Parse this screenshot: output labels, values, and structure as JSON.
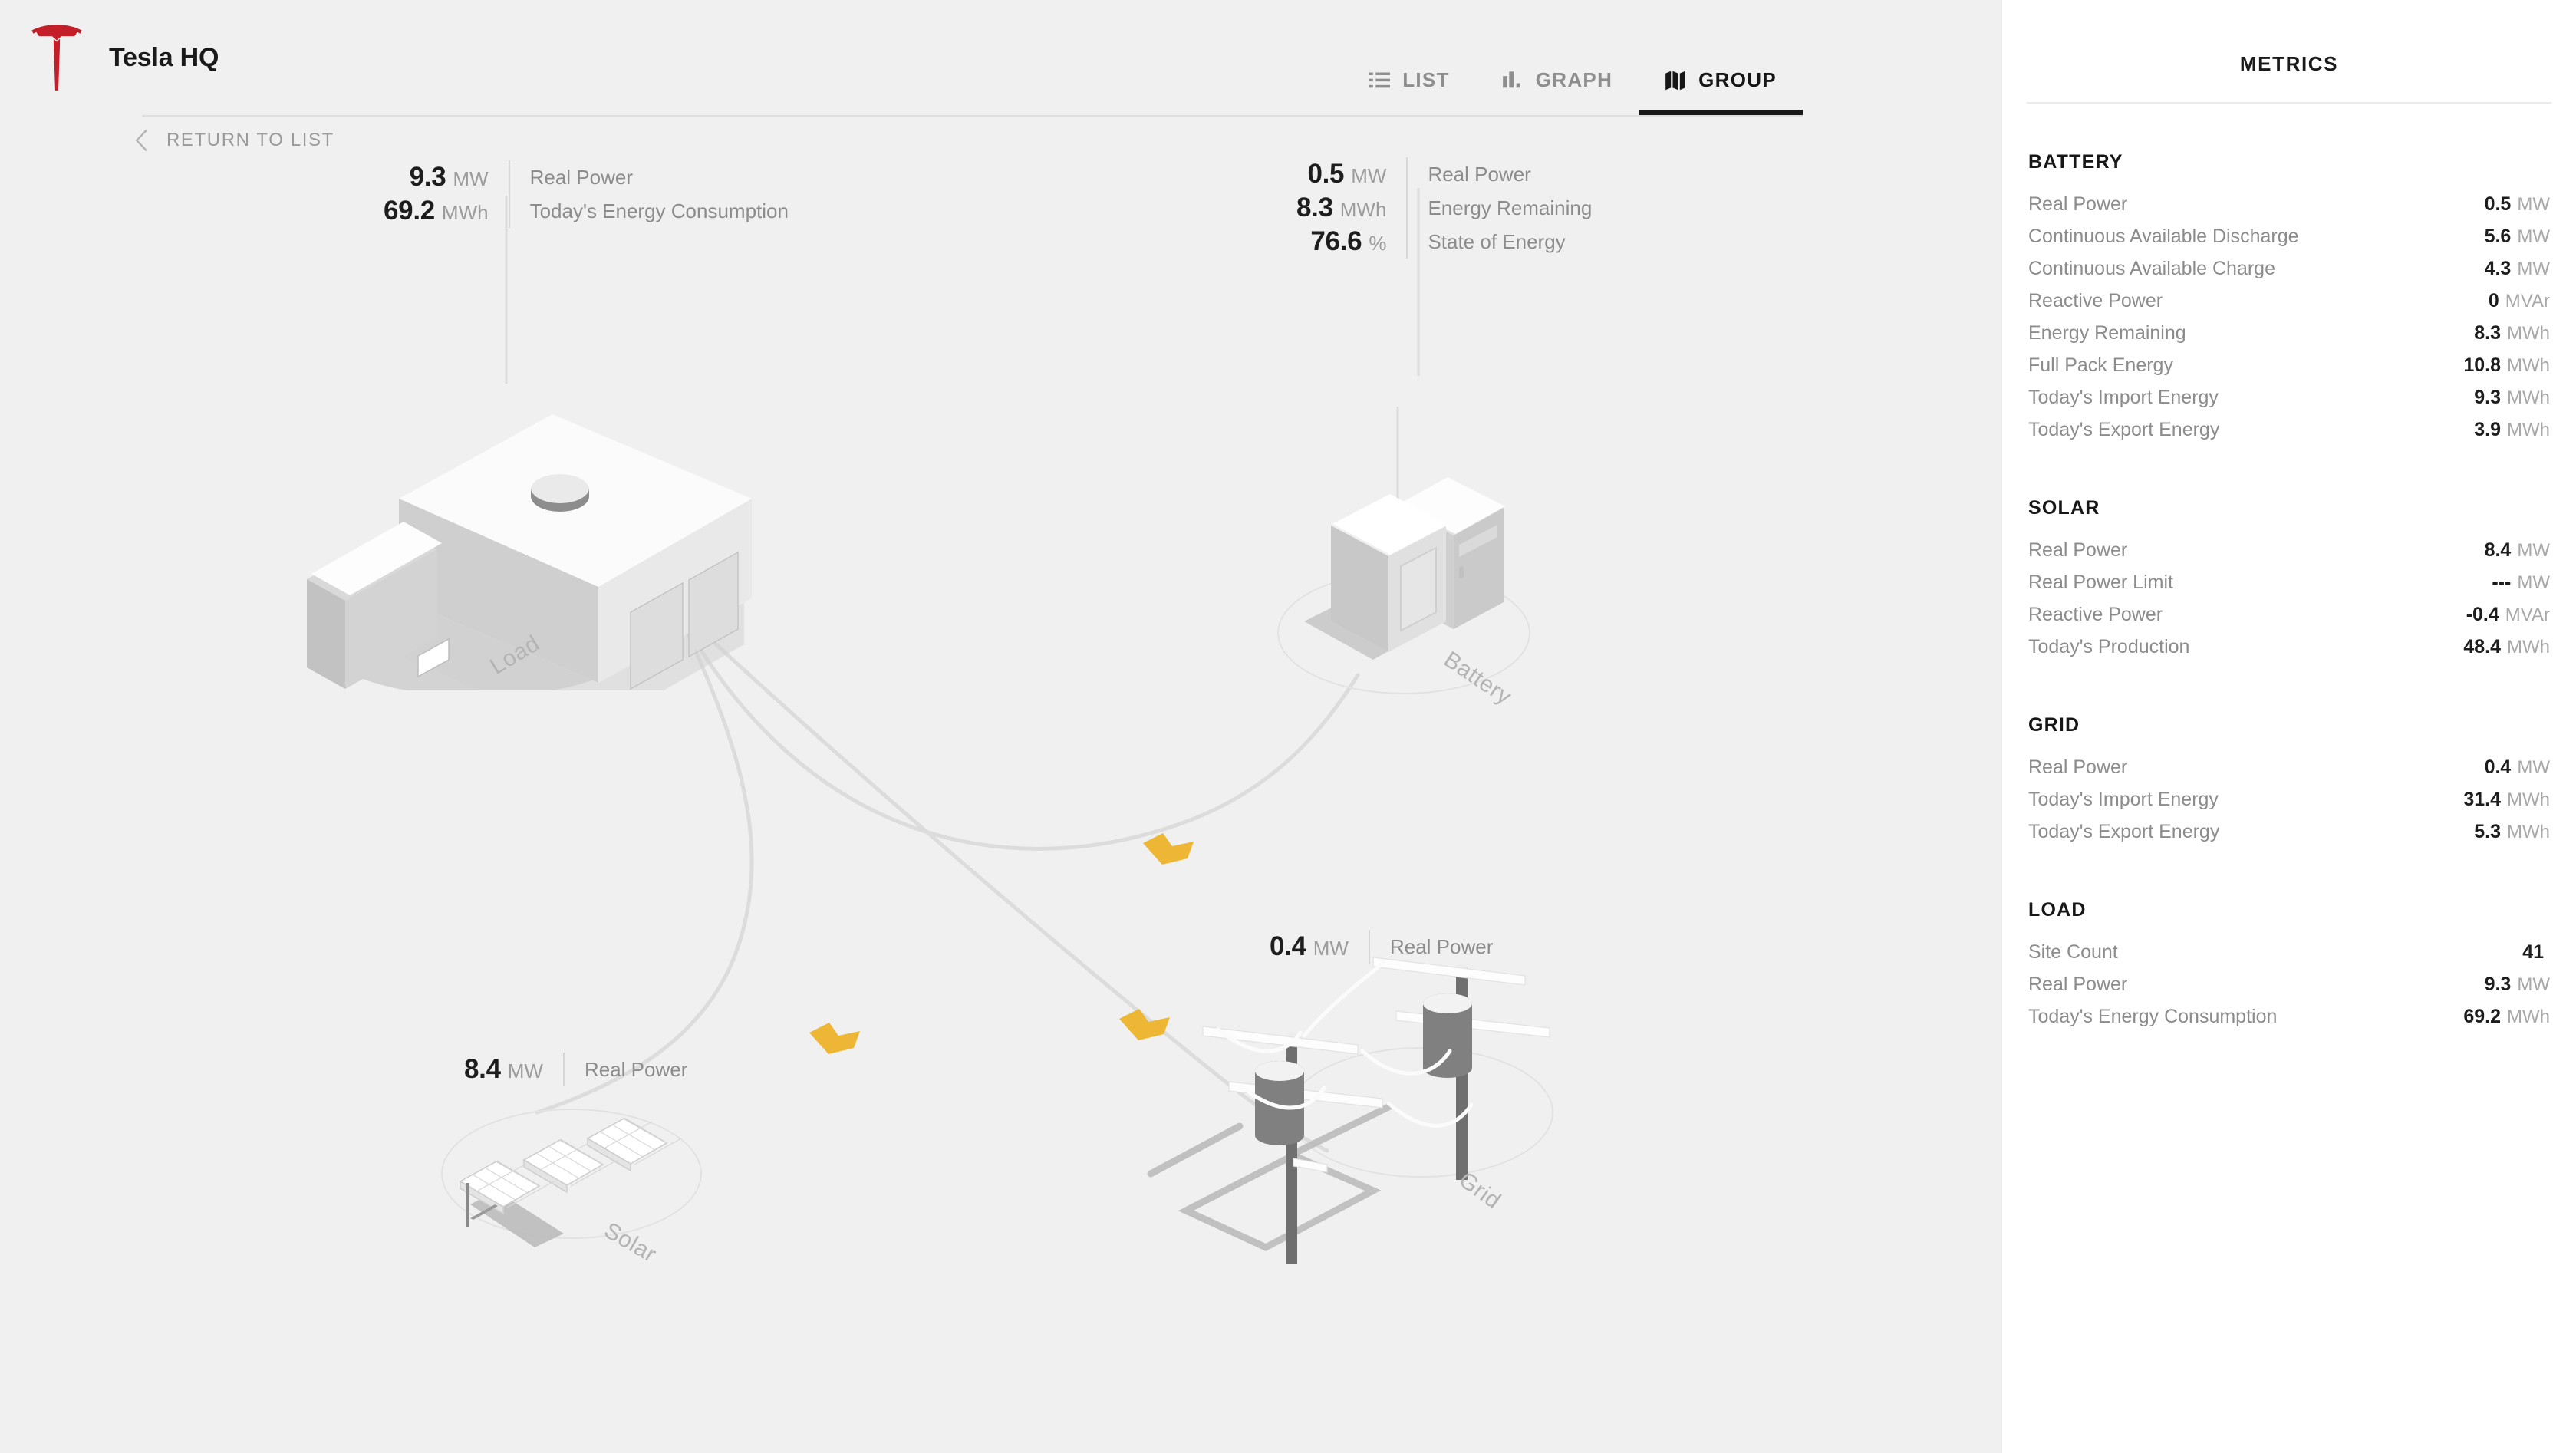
{
  "header": {
    "logo_icon": "tesla-logo-icon",
    "site_title": "Tesla HQ",
    "return_label": "RETURN TO LIST",
    "back_icon": "chevron-left-icon",
    "tabs": [
      {
        "label": "LIST",
        "icon": "list-icon",
        "active": false
      },
      {
        "label": "GRAPH",
        "icon": "bar-chart-icon",
        "active": false
      },
      {
        "label": "GROUP",
        "icon": "group-map-icon",
        "active": true
      }
    ]
  },
  "diagram": {
    "flow_marker_color": "#edb635",
    "wire_color": "#dcdcdc",
    "nodes": {
      "load": {
        "caption": "Load",
        "readout": [
          {
            "value": "9.3",
            "unit": "MW",
            "name": "Real Power"
          },
          {
            "value": "69.2",
            "unit": "MWh",
            "name": "Today's Energy Consumption"
          }
        ]
      },
      "battery": {
        "caption": "Battery",
        "readout": [
          {
            "value": "0.5",
            "unit": "MW",
            "name": "Real Power"
          },
          {
            "value": "8.3",
            "unit": "MWh",
            "name": "Energy Remaining"
          },
          {
            "value": "76.6",
            "unit": "%",
            "name": "State of Energy"
          }
        ]
      },
      "solar": {
        "caption": "Solar",
        "readout": [
          {
            "value": "8.4",
            "unit": "MW",
            "name": "Real Power"
          }
        ]
      },
      "grid": {
        "caption": "Grid",
        "readout": [
          {
            "value": "0.4",
            "unit": "MW",
            "name": "Real Power"
          }
        ]
      }
    }
  },
  "panel": {
    "title": "METRICS",
    "sections": [
      {
        "heading": "BATTERY",
        "rows": [
          {
            "label": "Real Power",
            "value": "0.5",
            "unit": "MW"
          },
          {
            "label": "Continuous Available Discharge",
            "value": "5.6",
            "unit": "MW"
          },
          {
            "label": "Continuous Available Charge",
            "value": "4.3",
            "unit": "MW"
          },
          {
            "label": "Reactive Power",
            "value": "0",
            "unit": "MVAr"
          },
          {
            "label": "Energy Remaining",
            "value": "8.3",
            "unit": "MWh"
          },
          {
            "label": "Full Pack Energy",
            "value": "10.8",
            "unit": "MWh"
          },
          {
            "label": "Today's Import Energy",
            "value": "9.3",
            "unit": "MWh"
          },
          {
            "label": "Today's Export Energy",
            "value": "3.9",
            "unit": "MWh"
          }
        ]
      },
      {
        "heading": "SOLAR",
        "rows": [
          {
            "label": "Real Power",
            "value": "8.4",
            "unit": "MW"
          },
          {
            "label": "Real Power Limit",
            "value": "---",
            "unit": "MW"
          },
          {
            "label": "Reactive Power",
            "value": "-0.4",
            "unit": "MVAr"
          },
          {
            "label": "Today's Production",
            "value": "48.4",
            "unit": "MWh"
          }
        ]
      },
      {
        "heading": "GRID",
        "rows": [
          {
            "label": "Real Power",
            "value": "0.4",
            "unit": "MW"
          },
          {
            "label": "Today's Import Energy",
            "value": "31.4",
            "unit": "MWh"
          },
          {
            "label": "Today's Export Energy",
            "value": "5.3",
            "unit": "MWh"
          }
        ]
      },
      {
        "heading": "LOAD",
        "rows": [
          {
            "label": "Site Count",
            "value": "41",
            "unit": ""
          },
          {
            "label": "Real Power",
            "value": "9.3",
            "unit": "MW"
          },
          {
            "label": "Today's Energy Consumption",
            "value": "69.2",
            "unit": "MWh"
          }
        ]
      }
    ]
  }
}
